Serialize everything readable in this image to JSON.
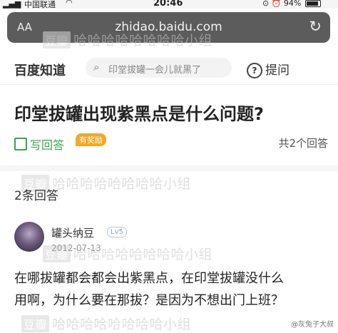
{
  "status_bar": {
    "carrier": "中国联通",
    "time": "20:46",
    "battery": "94%",
    "battery_level": 0.94
  },
  "url_bar": {
    "aa_label": "AA",
    "url": "zhidao.baidu.com"
  },
  "watermark": {
    "badge": "豆瓣",
    "text": "哈哈哈哈哈哈哈哈小组"
  },
  "nav": {
    "logo": "百度知道",
    "search_placeholder": "印堂拔罐一会儿就黑了",
    "ask_label": "提问"
  },
  "question": {
    "title": "印堂拔罐出现紫黑点是什么问题?",
    "answer_button": "写回答",
    "reward_badge": "有奖励",
    "answer_count": "共2个回答"
  },
  "answers": {
    "header": "2条回答",
    "first": {
      "username": "罐头纳豆",
      "level": "Lv5",
      "date": "2012-07-13",
      "line1": "在哪拔罐都会都会出紫黑点，在印堂拔罐没什么",
      "line2": "用啊，为什么要在那拔？是因为不想出门上班？"
    }
  },
  "credit": "@灰兔子大叔",
  "colors": {
    "accent_green": "#3aa34c",
    "reward_orange": "#f6a623",
    "url_bar_bg": "#5c5c5c"
  }
}
